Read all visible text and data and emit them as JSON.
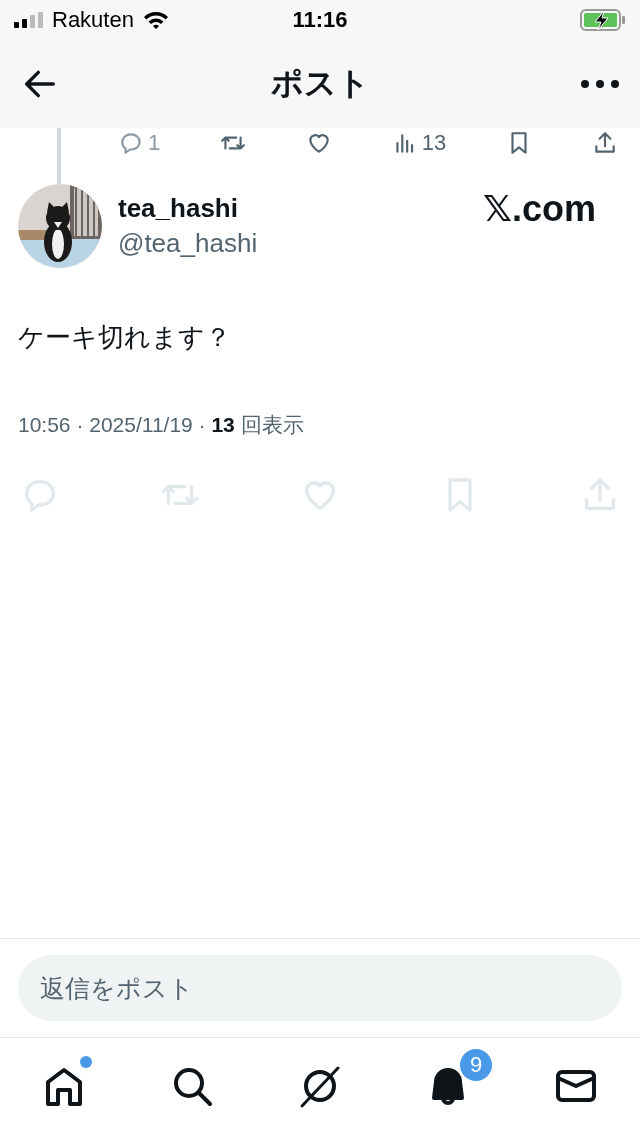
{
  "status_bar": {
    "carrier": "Rakuten",
    "time": "11:16",
    "charging": true
  },
  "header": {
    "title": "ポスト"
  },
  "previous_post_actions": [
    {
      "kind": "reply",
      "count": "1"
    },
    {
      "kind": "repost"
    },
    {
      "kind": "like"
    },
    {
      "kind": "views",
      "count": "13"
    },
    {
      "kind": "bookmark"
    },
    {
      "kind": "share"
    }
  ],
  "post": {
    "display_name": "tea_hashi",
    "handle": "@tea_hashi",
    "source_logo": "𝕏.com",
    "text": "ケーキ切れます？",
    "meta": "10:56 · 2025/11/19 · **13** 回表示",
    "actions": [
      {
        "kind": "reply"
      },
      {
        "kind": "repost"
      },
      {
        "kind": "like"
      },
      {
        "kind": "bookmark"
      },
      {
        "kind": "share"
      }
    ]
  },
  "reply_bar": {
    "placeholder": "返信をポスト"
  },
  "tab_bar": [
    {
      "kind": "home",
      "dot": true
    },
    {
      "kind": "search"
    },
    {
      "kind": "grok"
    },
    {
      "kind": "notifications",
      "badge": "9"
    },
    {
      "kind": "messages"
    }
  ]
}
